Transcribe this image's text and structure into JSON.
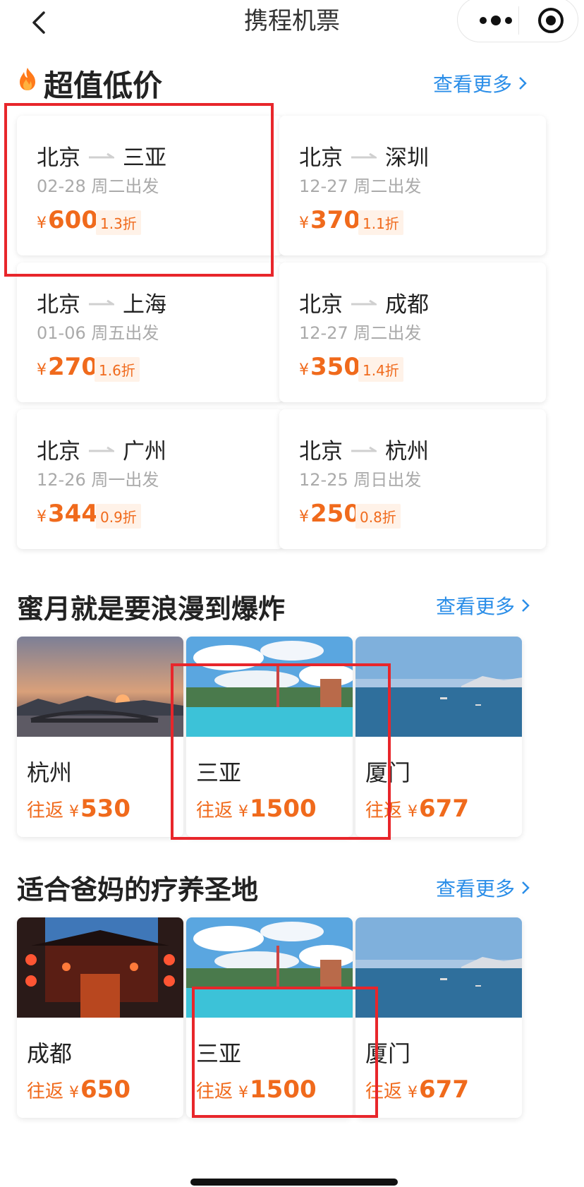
{
  "nav": {
    "title": "携程机票"
  },
  "deals": {
    "title": "超值低价",
    "more": "查看更多",
    "items": [
      {
        "from": "北京",
        "to": "三亚",
        "date": "02-28 周二出发",
        "price": "600",
        "discount": "1.3折"
      },
      {
        "from": "北京",
        "to": "深圳",
        "date": "12-27 周二出发",
        "price": "370",
        "discount": "1.1折"
      },
      {
        "from": "北京",
        "to": "上海",
        "date": "01-06 周五出发",
        "price": "270",
        "discount": "1.6折"
      },
      {
        "from": "北京",
        "to": "成都",
        "date": "12-27 周二出发",
        "price": "350",
        "discount": "1.4折"
      },
      {
        "from": "北京",
        "to": "广州",
        "date": "12-26 周一出发",
        "price": "344",
        "discount": "0.9折"
      },
      {
        "from": "北京",
        "to": "杭州",
        "date": "12-25 周日出发",
        "price": "250",
        "discount": "0.8折"
      }
    ],
    "currency": "¥"
  },
  "honeymoon": {
    "title": "蜜月就是要浪漫到爆炸",
    "more": "查看更多",
    "items": [
      {
        "name": "杭州",
        "label": "往返",
        "price": "530"
      },
      {
        "name": "三亚",
        "label": "往返",
        "price": "1500"
      },
      {
        "name": "厦门",
        "label": "往返",
        "price": "677"
      }
    ]
  },
  "parents": {
    "title": "适合爸妈的疗养圣地",
    "more": "查看更多",
    "items": [
      {
        "name": "成都",
        "label": "往返",
        "price": "650"
      },
      {
        "name": "三亚",
        "label": "往返",
        "price": "1500"
      },
      {
        "name": "厦门",
        "label": "往返",
        "price": "677"
      }
    ]
  },
  "colors": {
    "accent_blue": "#2b8ee8",
    "price_orange": "#f06a1c",
    "highlight_red": "#e8262b"
  },
  "icons": [
    "back-icon",
    "more-icon",
    "target-icon",
    "fire-icon",
    "chevron-right-icon",
    "arrow-right-icon"
  ]
}
